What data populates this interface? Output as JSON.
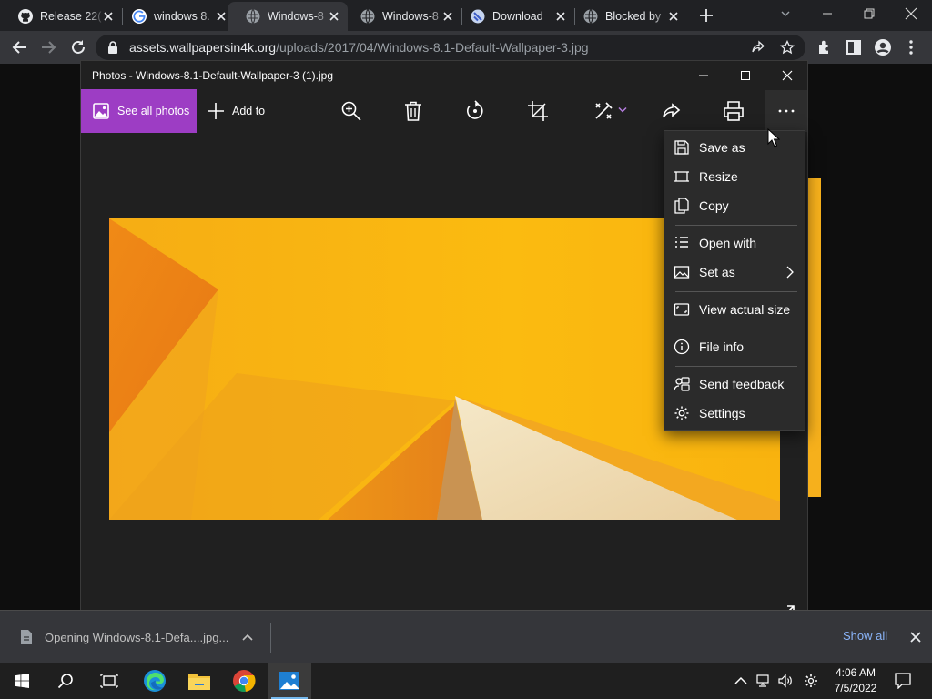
{
  "browser": {
    "tabs": [
      {
        "title": "Release 22(",
        "icon": "github-icon",
        "active": false
      },
      {
        "title": "windows 8.",
        "icon": "google-icon",
        "active": false
      },
      {
        "title": "Windows-8",
        "icon": "globe-icon",
        "active": true
      },
      {
        "title": "Windows-8",
        "icon": "globe-icon",
        "active": false
      },
      {
        "title": "Download",
        "icon": "site-icon",
        "active": false
      },
      {
        "title": "Blocked by",
        "icon": "globe-icon",
        "active": false
      }
    ],
    "url_host": "assets.wallpapersin4k.org",
    "url_path": "/uploads/2017/04/Windows-8.1-Default-Wallpaper-3.jpg"
  },
  "photos": {
    "title": "Photos - Windows-8.1-Default-Wallpaper-3 (1).jpg",
    "see_all_label": "See all photos",
    "add_to_label": "Add to",
    "accent": "#9d3dc4",
    "menu": {
      "save_as": "Save as",
      "resize": "Resize",
      "copy": "Copy",
      "open_with": "Open with",
      "set_as": "Set as",
      "view_actual_size": "View actual size",
      "file_info": "File info",
      "send_feedback": "Send feedback",
      "settings": "Settings"
    }
  },
  "downloads": {
    "item_text": "Opening Windows-8.1-Defa....jpg...",
    "show_all": "Show all"
  },
  "taskbar": {
    "time": "4:06 AM",
    "date": "7/5/2022"
  }
}
